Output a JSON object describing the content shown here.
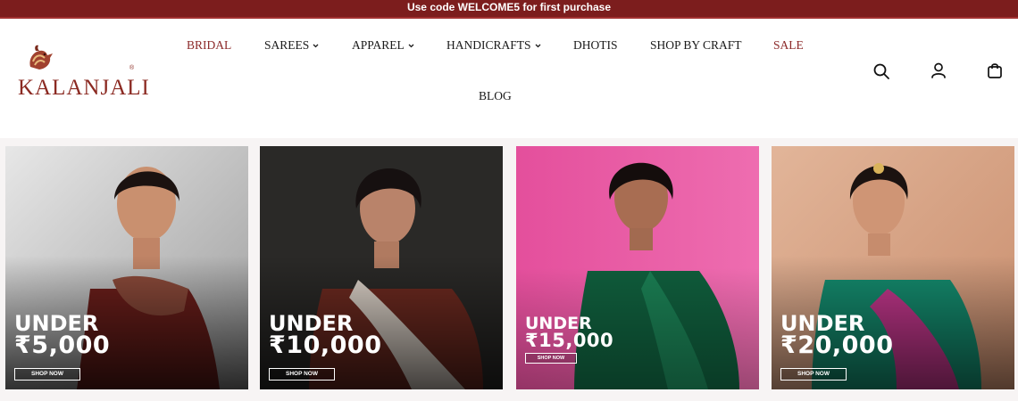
{
  "promo": {
    "text": "Use code WELCOME5 for first purchase",
    "background": "#7c1d1d"
  },
  "brand": {
    "name": "KALANJALI",
    "reg": "®",
    "color": "#8b2a22"
  },
  "nav": {
    "items": [
      {
        "label": "BRIDAL",
        "accent": true,
        "dropdown": false
      },
      {
        "label": "SAREES",
        "accent": false,
        "dropdown": true
      },
      {
        "label": "APPAREL",
        "accent": false,
        "dropdown": true
      },
      {
        "label": "HANDICRAFTS",
        "accent": false,
        "dropdown": true
      },
      {
        "label": "DHOTIS",
        "accent": false,
        "dropdown": false
      },
      {
        "label": "SHOP BY CRAFT",
        "accent": false,
        "dropdown": false
      },
      {
        "label": "SALE",
        "accent": true,
        "dropdown": false
      },
      {
        "label": "BLOG",
        "accent": false,
        "dropdown": false
      }
    ],
    "accent_color": "#8c2a2a"
  },
  "header_icons": [
    "search-icon",
    "user-icon",
    "bag-icon"
  ],
  "banners": [
    {
      "under": "UNDER",
      "price": "₹5,000",
      "cta": "SHOP NOW",
      "bg": "#cfcfcf"
    },
    {
      "under": "UNDER",
      "price": "₹10,000",
      "cta": "SHOP NOW",
      "bg": "#2b2a29"
    },
    {
      "under": "UNDER",
      "price": "₹15,000",
      "cta": "SHOP NOW",
      "bg": "#e95ca6"
    },
    {
      "under": "UNDER",
      "price": "₹20,000",
      "cta": "SHOP NOW",
      "bg": "#d9a78a"
    }
  ]
}
